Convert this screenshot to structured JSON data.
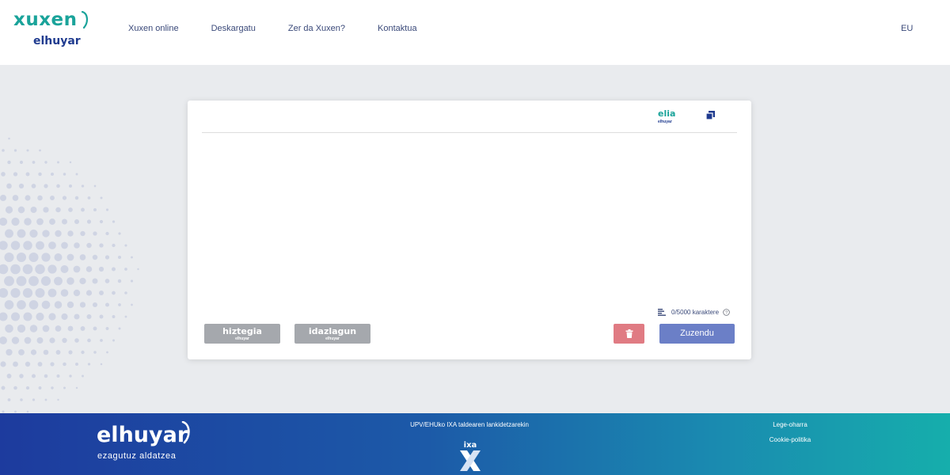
{
  "header": {
    "logo_top": "xuxen",
    "logo_bottom": "elhuyar",
    "nav": [
      "Xuxen online",
      "Deskargatu",
      "Zer da Xuxen?",
      "Kontaktua"
    ],
    "language": "EU"
  },
  "editor": {
    "elia_main": "elia",
    "elia_sub": "elhuyar",
    "textarea_value": "",
    "char_counter": "0/5000 karaktere",
    "hiztegia_main": "hiztegia",
    "hiztegia_sub": "elhuyar",
    "idazlagun_main": "idazlagun",
    "idazlagun_sub": "elhuyar",
    "submit_label": "Zuzendu"
  },
  "footer": {
    "logo_main": "elhuyar",
    "logo_sub": "ezagutuz aldatzea",
    "collab_text": "UPV/EHUko IXA taldearen lankidetzarekin",
    "ixa_text": "ixa",
    "links": [
      "Lege-oharra",
      "Cookie-politika"
    ]
  },
  "colors": {
    "brand_teal": "#1aa39a",
    "brand_blue": "#1f3b8f",
    "submit": "#6b7fc7",
    "delete": "#e07b83",
    "disabled_gray": "#a5a8ad"
  },
  "icons": [
    "copy-icon",
    "text-lines-icon",
    "help-circle-icon",
    "trash-icon"
  ]
}
